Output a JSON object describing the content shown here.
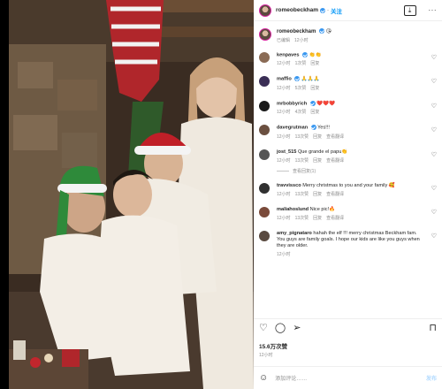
{
  "header": {
    "username": "romeobeckham",
    "follow_label": "关注"
  },
  "caption": {
    "username": "romeobeckham",
    "text": "😘",
    "edited_label": "已编辑",
    "time": "12小时"
  },
  "comments": [
    {
      "username": "kenpaves",
      "text": "👏👏",
      "time": "12小时",
      "likes": "1次赞",
      "reply": "回复",
      "translate": "",
      "avatar_color": "#8a6b55"
    },
    {
      "username": "maffio",
      "text": "🙏🙏🙏",
      "time": "12小时",
      "likes": "5次赞",
      "reply": "回复",
      "translate": "",
      "avatar_color": "#3a2e55"
    },
    {
      "username": "mrbobbyrich",
      "text": "❤️❤️❤️",
      "time": "12小时",
      "likes": "4次赞",
      "reply": "回复",
      "translate": "",
      "avatar_color": "#1a1a1a"
    },
    {
      "username": "davegrutman",
      "text": "Yes!!!",
      "time": "12小时",
      "likes": "13次赞",
      "reply": "回复",
      "translate": "查看翻译",
      "avatar_color": "#6b5040"
    },
    {
      "username": "jost_515",
      "text": "Que grande el papu👏",
      "time": "12小时",
      "likes": "13次赞",
      "reply": "回复",
      "translate": "查看翻译",
      "avatar_color": "#555555",
      "view_replies": "查看回复(1)"
    },
    {
      "username": "travvissco",
      "text": "Merry christmas to you and your family 🥰",
      "time": "12小时",
      "likes": "13次赞",
      "reply": "回复",
      "translate": "查看翻译",
      "avatar_color": "#303030"
    },
    {
      "username": "maliahoslund",
      "text": "Nice pic!🔥",
      "time": "12小时",
      "likes": "13次赞",
      "reply": "回复",
      "translate": "查看翻译",
      "avatar_color": "#7a4a3a"
    },
    {
      "username": "amy_pignataro",
      "text": "hahah the elf !!! merry christmas Beckham fam. You guys are family goals. I hope our kids are like you guys when they are older.",
      "time": "12小时",
      "likes": "",
      "reply": "",
      "translate": "",
      "avatar_color": "#5a4a40"
    }
  ],
  "actions": {
    "likes": "15.6万次赞",
    "time": "12小时"
  },
  "add_comment": {
    "placeholder": "添加评论……",
    "post_label": "发布"
  }
}
